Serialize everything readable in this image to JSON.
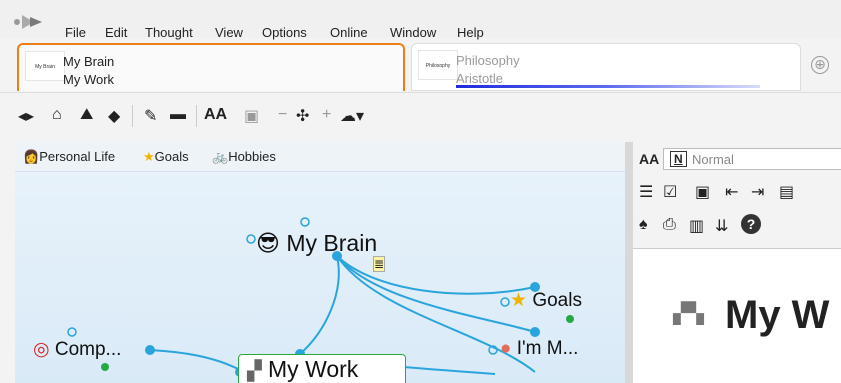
{
  "menu": {
    "items": [
      "File",
      "Edit",
      "Thought",
      "View",
      "Options",
      "Online",
      "Window",
      "Help"
    ]
  },
  "tabs": [
    {
      "thumb_text": "My Brain",
      "line1": "My Brain",
      "line2": "My Work",
      "active": true
    },
    {
      "thumb_text": "Philosophy",
      "line1": "Philosophy",
      "line2": "Aristotle",
      "active": false
    }
  ],
  "add_tab_glyph": "⊕",
  "toolbar": {
    "icons": [
      "back-forward-icon",
      "home-icon",
      "brain-image-icon",
      "tag-icon",
      "pin-icon",
      "folder-icon",
      "font-size-icon",
      "ai-chip-icon",
      "zoom-minus-icon",
      "layout-icon",
      "zoom-plus-icon",
      "cloud-icon"
    ],
    "font_label": "AA"
  },
  "pins": [
    {
      "label": "Personal Life",
      "icon": "👩"
    },
    {
      "label": "Goals",
      "icon": "★"
    },
    {
      "label": "Hobbies",
      "icon": "🚲"
    }
  ],
  "notes": {
    "aa_label": "AA",
    "style_letter": "N",
    "style_value": "Normal",
    "doc_title": "My W",
    "help_glyph": "?"
  },
  "plex": {
    "active_thought": "My Brain",
    "children": [
      "Goals",
      "I'm M..."
    ],
    "jump": "Comp...",
    "focus": "My Work"
  },
  "colors": {
    "accent": "#ef7d16",
    "link": "#2aa4dc",
    "node_green": "#28a745"
  }
}
